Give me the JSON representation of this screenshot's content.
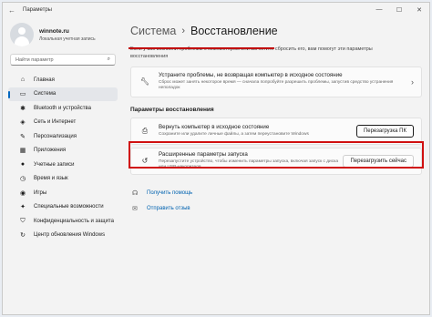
{
  "window": {
    "title": "Параметры",
    "controls": {
      "minimize": "—",
      "maximize": "☐",
      "close": "✕"
    }
  },
  "profile": {
    "name": "winnote.ru",
    "subtitle": "Локальная учетная запись"
  },
  "search": {
    "placeholder": "Найти параметр"
  },
  "nav": [
    {
      "label": "Главная",
      "icon": "home-icon",
      "glyph": "⌂"
    },
    {
      "label": "Система",
      "icon": "system-icon",
      "glyph": "▭"
    },
    {
      "label": "Bluetooth и устройства",
      "icon": "bluetooth-icon",
      "glyph": "✱"
    },
    {
      "label": "Сеть и Интернет",
      "icon": "network-icon",
      "glyph": "◈"
    },
    {
      "label": "Персонализация",
      "icon": "brush-icon",
      "glyph": "✎"
    },
    {
      "label": "Приложения",
      "icon": "apps-icon",
      "glyph": "▦"
    },
    {
      "label": "Учетные записи",
      "icon": "accounts-icon",
      "glyph": "●"
    },
    {
      "label": "Время и язык",
      "icon": "globe-icon",
      "glyph": "◷"
    },
    {
      "label": "Игры",
      "icon": "gamepad-icon",
      "glyph": "◉"
    },
    {
      "label": "Специальные возможности",
      "icon": "accessibility-icon",
      "glyph": "✦"
    },
    {
      "label": "Конфиденциальность и защита",
      "icon": "shield-icon",
      "glyph": "⛉"
    },
    {
      "label": "Центр обновления Windows",
      "icon": "update-icon",
      "glyph": "↻"
    }
  ],
  "breadcrumb": {
    "parent": "Система",
    "separator": "›",
    "current": "Восстановление"
  },
  "intro": "Если у вас возникли проблемы с компьютером или вы хотите сбросить его, вам помогут эти параметры восстановления",
  "troubleshoot_card": {
    "title": "Устраните проблемы, не возвращая компьютер в исходное состояние",
    "description": "Сброс может занять некоторое время — сначала попробуйте разрешить проблемы, запустив средство устранения неполадок"
  },
  "section": {
    "title": "Параметры восстановления"
  },
  "reset_card": {
    "title": "Вернуть компьютер в исходное состояние",
    "description": "Сохраните или удалите личные файлы, а затем переустановите Windows",
    "button": "Перезагрузка ПК"
  },
  "advanced_card": {
    "title": "Расширенные параметры запуска",
    "description": "Перезапустите устройство, чтобы изменить параметры запуска, включая запуск с диска или USB-накопителя",
    "button": "Перезагрузить сейчас"
  },
  "links": {
    "help": "Получить помощь",
    "feedback": "Отправить отзыв"
  },
  "colors": {
    "accent": "#0067c0",
    "highlight": "#d01010",
    "link": "#0062b0"
  }
}
